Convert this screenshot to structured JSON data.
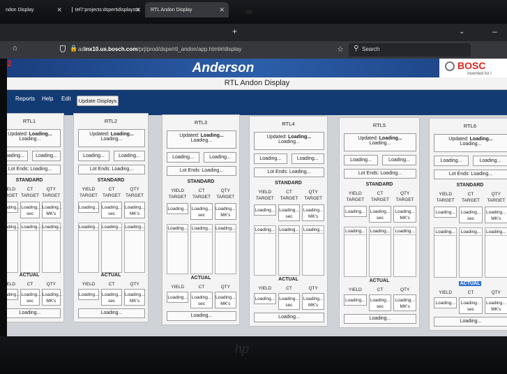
{
  "browser": {
    "tabs": [
      {
        "label": "ndon Display"
      },
      {
        "label": "tef7:projects:dspertidisplaysta"
      },
      {
        "label": "RTL Andon Display"
      }
    ],
    "url_prefix": "ad",
    "url_host": "inx10.us.bosch.com",
    "url_path": "/prj/prod/dspe/rtl_andon/app.html#/display",
    "search_label": "Search"
  },
  "header": {
    "brand": "Anderson",
    "logo_text": "BOSC",
    "logo_tagline": "Invented for l",
    "red_fragment": "2",
    "subtitle": "RTL Andon Display"
  },
  "menu": {
    "reports": "Reports",
    "help": "Help",
    "edit": "Edit",
    "update": "Update Displays"
  },
  "labels": {
    "updated": "Updated:",
    "loading": "Loading...",
    "lot_ends": "Lot Ends:",
    "standard": "STANDARD",
    "actual": "ACTUAL",
    "yield": "YIELD",
    "ct": "CT",
    "qty": "QTY",
    "target": "TARGET",
    "sec": "sec",
    "mks": "MK's"
  },
  "panels": [
    {
      "name": "RTL1"
    },
    {
      "name": "RTL2"
    },
    {
      "name": "RTL3"
    },
    {
      "name": "RTL4"
    },
    {
      "name": "RTL5"
    },
    {
      "name": "RTL6"
    }
  ],
  "colors": {
    "header_blue": "#2b5ea9",
    "menu_blue": "#123a73",
    "bosch_red": "#e3241b",
    "highlight": "#2b6fd6"
  }
}
